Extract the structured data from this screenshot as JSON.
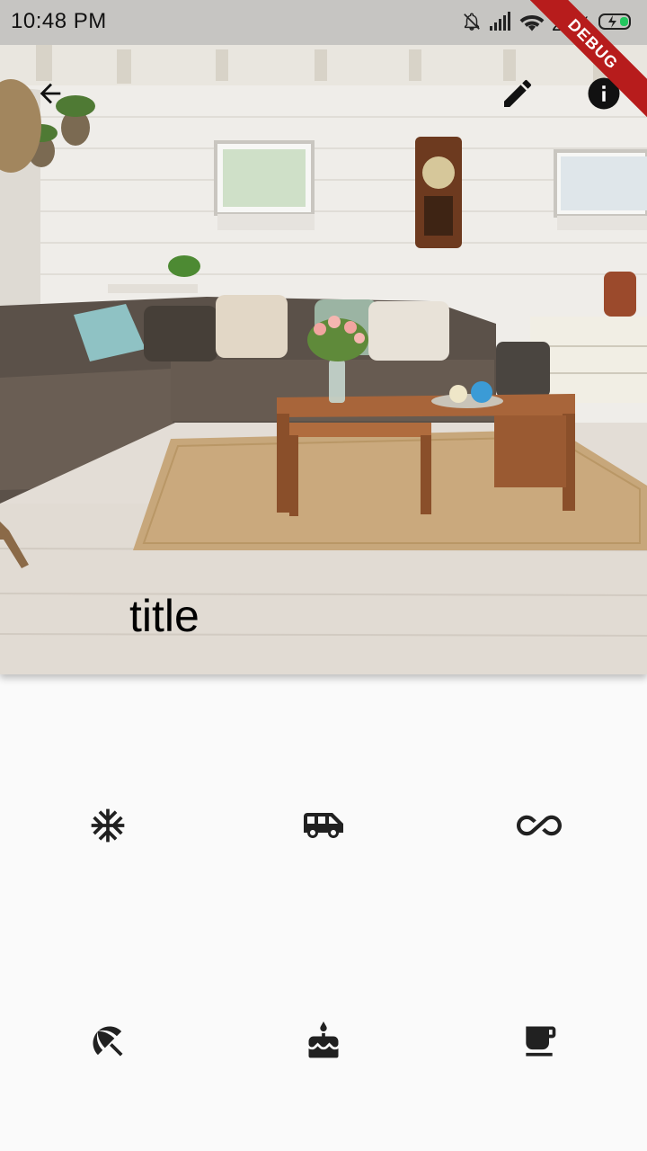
{
  "status_bar": {
    "time": "10:48 PM",
    "battery": "28%",
    "icons": [
      "notifications-off-icon",
      "signal-icon",
      "wifi-icon",
      "battery-charging-icon"
    ]
  },
  "debug_banner": "DEBUG",
  "app_bar": {
    "back_icon": "arrow-back-icon",
    "actions": [
      "edit-icon",
      "info-icon"
    ]
  },
  "hero": {
    "title": "title"
  },
  "grid": {
    "icons": [
      "ac-unit-icon",
      "airport-shuttle-icon",
      "all-inclusive-icon",
      "beach-access-icon",
      "cake-icon",
      "free-breakfast-icon"
    ]
  },
  "colors": {
    "background": "#fafafa",
    "icon": "#212121",
    "debug_ribbon": "#b71c1c"
  }
}
